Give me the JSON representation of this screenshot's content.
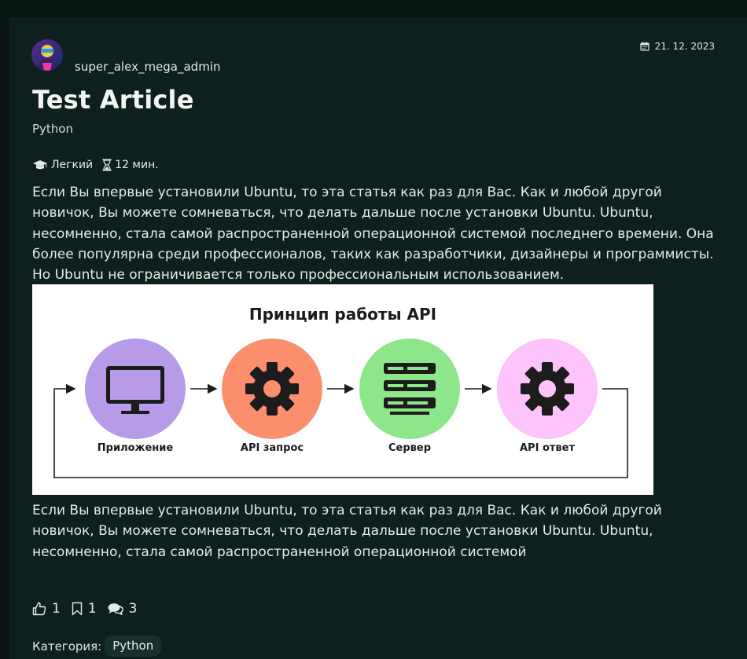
{
  "author": {
    "username": "super_alex_mega_admin"
  },
  "post": {
    "date": "21. 12. 2023",
    "title": "Test Article",
    "subtitle": "Python",
    "difficulty": "Легкий",
    "read_time": "12 мин.",
    "paragraph_1": "Если Вы впервые установили Ubuntu, то эта статья как раз для Вас. Как и любой другой новичок, Вы можете сомневаться, что делать дальше после установки Ubuntu. Ubuntu, несомненно, стала самой распространенной операционной системой последнего времени. Она более популярна среди профессионалов, таких как разработчики, дизайнеры и программисты. Но Ubuntu не ограничивается только профессиональным использованием.",
    "paragraph_2": "Если Вы впервые установили Ubuntu, то эта статья как раз для Вас. Как и любой другой новичок, Вы можете сомневаться, что делать дальше после установки Ubuntu. Ubuntu, несомненно, стала самой распространенной операционной системой"
  },
  "figure": {
    "title": "Принцип работы API",
    "steps": [
      {
        "label": "Приложение",
        "color": "#b79be8",
        "icon": "monitor-icon"
      },
      {
        "label": "API запрос",
        "color": "#fb8f6d",
        "icon": "gear-icon"
      },
      {
        "label": "Сервер",
        "color": "#8ee68a",
        "icon": "server-icon"
      },
      {
        "label": "API ответ",
        "color": "#fdc3fb",
        "icon": "gear-icon"
      }
    ]
  },
  "actions": {
    "likes": "1",
    "bookmarks": "1",
    "comments": "3"
  },
  "category": {
    "label": "Категория:",
    "value": "Python"
  },
  "colors": {
    "page_background": "#0a1614",
    "card_background": "#0e201d",
    "tag_background": "#17302c",
    "text": "#e3ebe9"
  }
}
